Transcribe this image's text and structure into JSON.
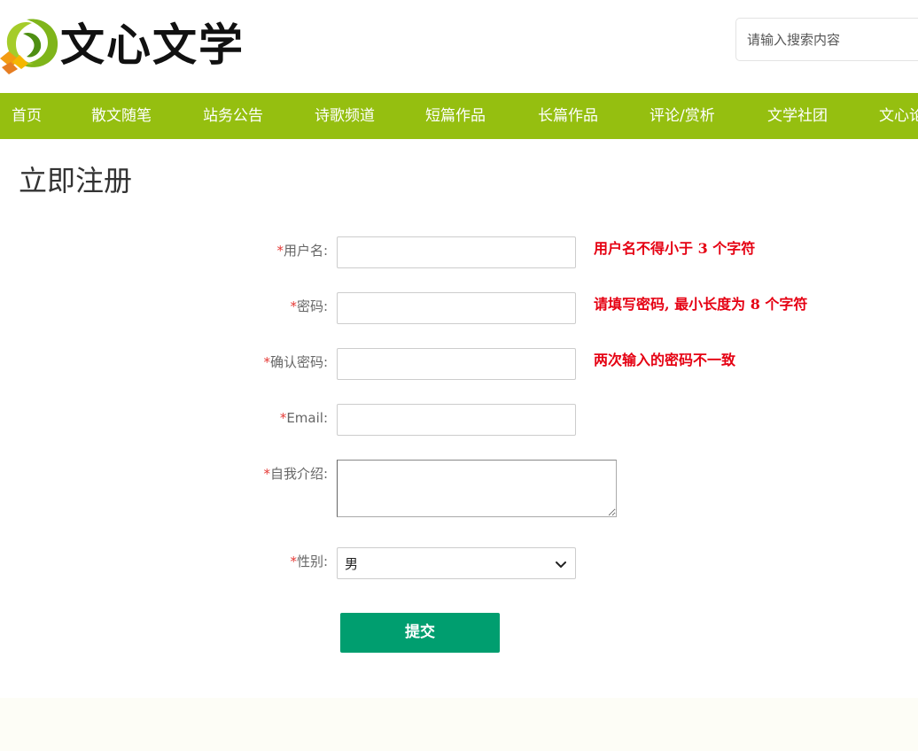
{
  "header": {
    "logo_text": "文心文学",
    "search": {
      "placeholder": "请输入搜索内容",
      "value": ""
    }
  },
  "nav": {
    "items": [
      {
        "label": "首页"
      },
      {
        "label": "散文随笔"
      },
      {
        "label": "站务公告"
      },
      {
        "label": "诗歌频道"
      },
      {
        "label": "短篇作品"
      },
      {
        "label": "长篇作品"
      },
      {
        "label": "评论/赏析"
      },
      {
        "label": "文学社团"
      },
      {
        "label": "文心论"
      }
    ],
    "background_color": "#95bf10"
  },
  "page_title": "立即注册",
  "form": {
    "required_mark": "*",
    "username": {
      "label": "用户名:",
      "value": "",
      "error": "用户名不得小于 3 个字符"
    },
    "password": {
      "label": "密码:",
      "value": "",
      "error": "请填写密码, 最小长度为 8 个字符"
    },
    "confirm_password": {
      "label": "确认密码:",
      "value": "",
      "error": "两次输入的密码不一致"
    },
    "email": {
      "label": "Email:",
      "value": ""
    },
    "intro": {
      "label": "自我介绍:",
      "value": ""
    },
    "gender": {
      "label": "性别:",
      "selected": "男"
    },
    "submit_label": "提交",
    "error_color": "#e50012",
    "submit_color": "#009e6f"
  }
}
